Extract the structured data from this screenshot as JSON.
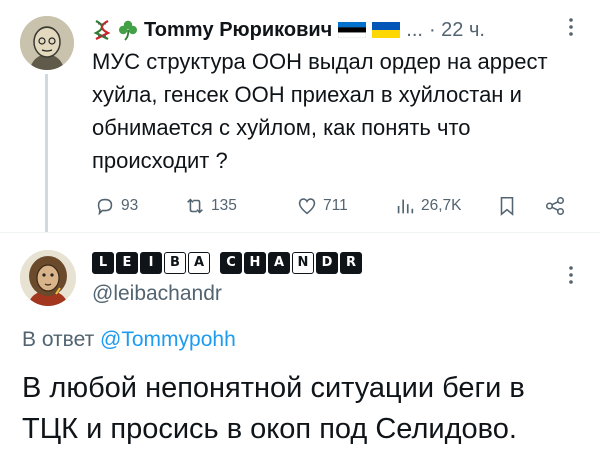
{
  "tweet": {
    "emoji_prefix": [
      "dna-icon",
      "shamrock-icon"
    ],
    "author_name": "Tommy Рюрикович",
    "author_flags": [
      "estonia-flag",
      "ukraine-flag"
    ],
    "name_ellipsis": "...",
    "timestamp": "· 22 ч.",
    "text": "МУС структура ООН выдал ордер на аррест хуйла, генсек ООН приехал в хуйлостан и обнимается с хуйлом, как понять что происходит ?",
    "actions": {
      "replies": "93",
      "retweets": "135",
      "likes": "711",
      "views": "26,7K"
    }
  },
  "reply": {
    "display_name_chars": [
      "L",
      "E",
      "I",
      "B",
      "A",
      " ",
      "C",
      "H",
      "A",
      "N",
      "D",
      "R"
    ],
    "handle": "@leibachandr",
    "reply_to_label": "В ответ",
    "reply_to_mention": "@Tommypohh",
    "text": "В любой непонятной ситуации беги в ТЦК и просись в окоп под Селидово."
  },
  "colors": {
    "text": "#0f1419",
    "secondary": "#536471",
    "accent": "#1d9bf0",
    "thread_line": "#cfd9de"
  }
}
